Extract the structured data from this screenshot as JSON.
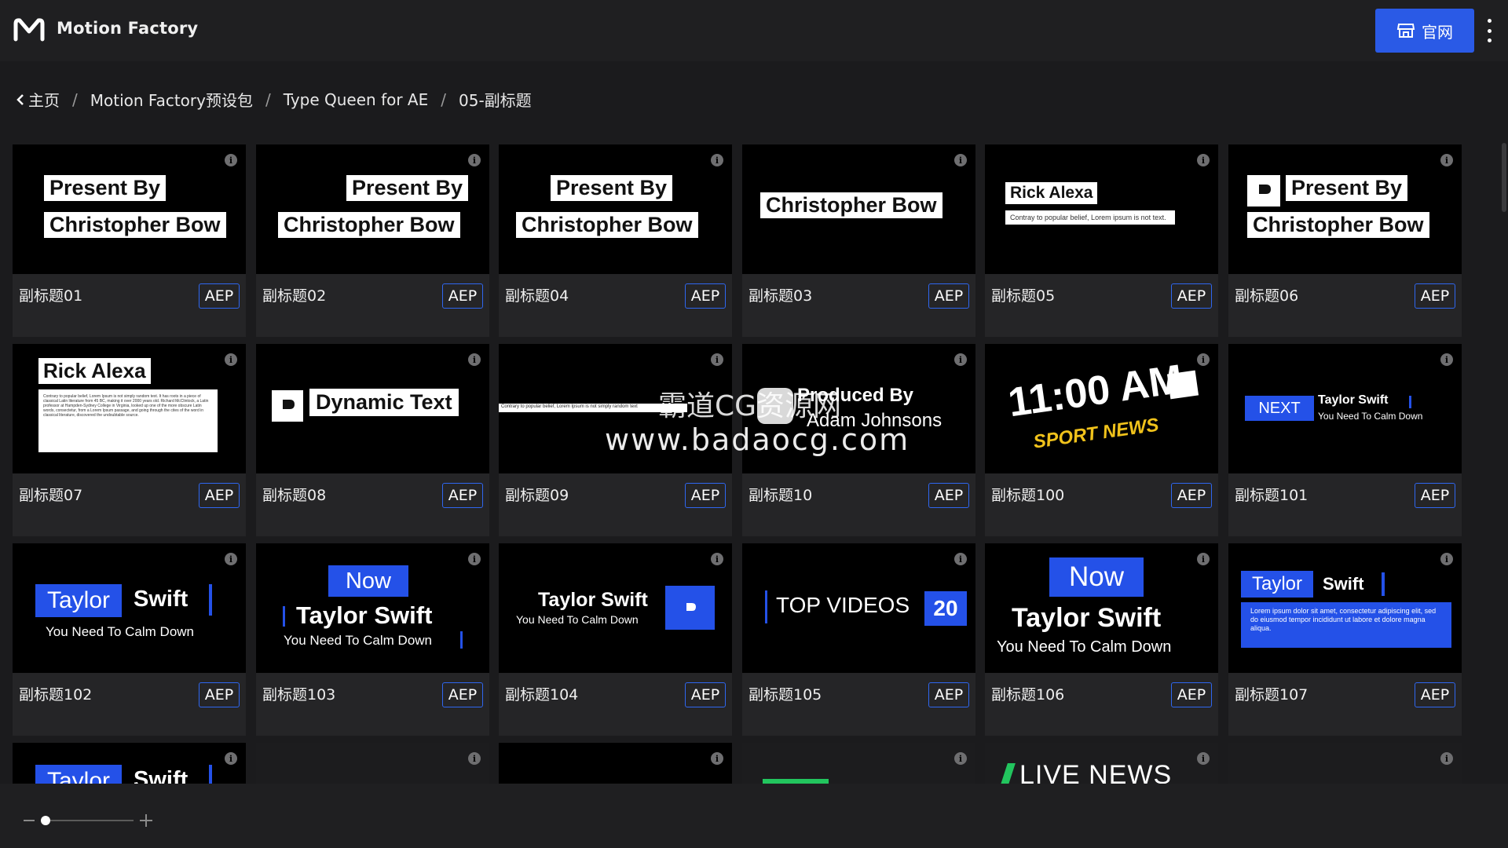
{
  "app": {
    "title": "Motion Factory"
  },
  "header": {
    "site_button_label": "官网"
  },
  "breadcrumb": {
    "items": [
      "主页",
      "Motion Factory预设包",
      "Type Queen for AE",
      "05-副标题"
    ],
    "separator": "/"
  },
  "badge_label": "AEP",
  "cards": [
    {
      "label": "副标题01"
    },
    {
      "label": "副标题02"
    },
    {
      "label": "副标题04"
    },
    {
      "label": "副标题03"
    },
    {
      "label": "副标题05"
    },
    {
      "label": "副标题06"
    },
    {
      "label": "副标题07"
    },
    {
      "label": "副标题08"
    },
    {
      "label": "副标题09"
    },
    {
      "label": "副标题10"
    },
    {
      "label": "副标题100"
    },
    {
      "label": "副标题101"
    },
    {
      "label": "副标题102"
    },
    {
      "label": "副标题103"
    },
    {
      "label": "副标题104"
    },
    {
      "label": "副标题105"
    },
    {
      "label": "副标题106"
    },
    {
      "label": "副标题107"
    }
  ],
  "thumb_text": {
    "present_by": "Present By",
    "christopher": "Christopher Bow",
    "rick": "Rick Alexa",
    "contrary": "Contray to popular belief, Lorem ipsum is not text.",
    "lorem_long": "Contrary to popular belief, Lorem Ipsum is not simply random text. It has roots in a piece of classical Latin literature from 45 BC, making it over 2000 years old. Richard McClintock, a Latin professor at Hampden-Sydney College in Virginia, looked up one of the more obscure Latin words, consectetur, from a Lorem Ipsum passage, and going through the cites of the word in classical literature, discovered the undoubtable source.",
    "dynamic": "Dynamic Text",
    "contrary9": "Contrary to popular belief, Lorem Ipsum is not simply random text",
    "produced": "Produced By",
    "adam": "Adam Johnsons",
    "time": "11:00 AM",
    "sport": "SPORT NEWS",
    "next": "NEXT",
    "taylor_swift": "Taylor Swift",
    "calm": "You Need To Calm Down",
    "taylor": "Taylor",
    "swift": "Swift",
    "now": "Now",
    "top_videos": "TOP VIDEOS",
    "twenty": "20",
    "lorem107": "Lorem ipsum dolor sit amet, consectetur adipiscing elit, sed do eiusmod tempor incididunt ut labore et dolore magna aliqua.",
    "live_news": "LIVE NEWS"
  },
  "watermark": {
    "line1": "霸道CG资源网",
    "line2": "www.badaocg.com"
  },
  "colors": {
    "accent": "#2a5ae6",
    "badge_border": "#2f67f0",
    "background": "#1b1b1d"
  }
}
